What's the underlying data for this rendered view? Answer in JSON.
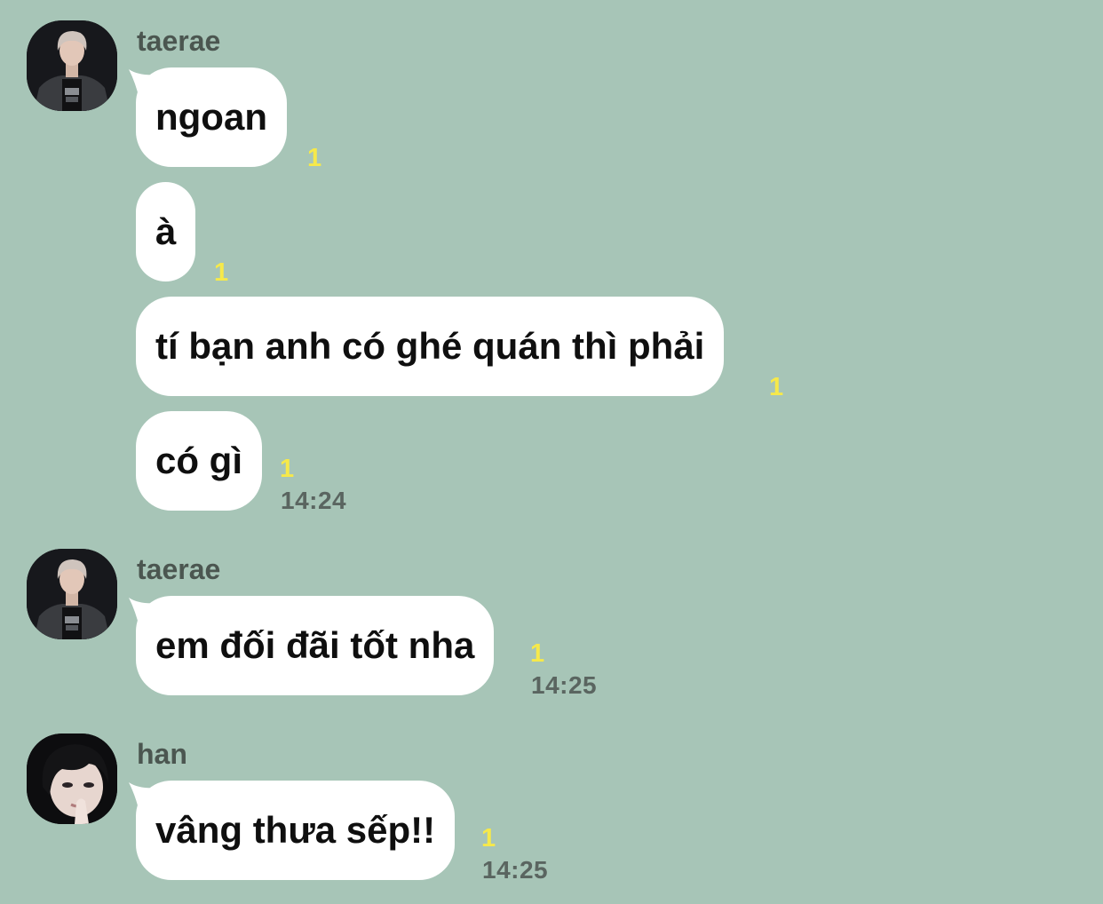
{
  "colors": {
    "background": "#a7c5b7",
    "bubble": "#ffffff",
    "unread_badge": "#f6e94a",
    "sender_name": "#4b5650",
    "timestamp": "#5a6560"
  },
  "groups": [
    {
      "sender": "taerae",
      "avatar_icon": "profile-photo-taerae",
      "messages": [
        {
          "text": "ngoan",
          "unread": "1"
        },
        {
          "text": "à",
          "unread": "1"
        },
        {
          "text": "tí bạn anh có ghé quán thì phải",
          "unread": "1"
        },
        {
          "text": "có gì",
          "unread": "1",
          "time": "14:24"
        }
      ]
    },
    {
      "sender": "taerae",
      "avatar_icon": "profile-photo-taerae",
      "messages": [
        {
          "text": "em đối đãi tốt nha",
          "unread": "1",
          "time": "14:25"
        }
      ]
    },
    {
      "sender": "han",
      "avatar_icon": "profile-photo-han",
      "messages": [
        {
          "text": "vâng thưa sếp!!",
          "unread": "1",
          "time": "14:25"
        }
      ]
    }
  ]
}
